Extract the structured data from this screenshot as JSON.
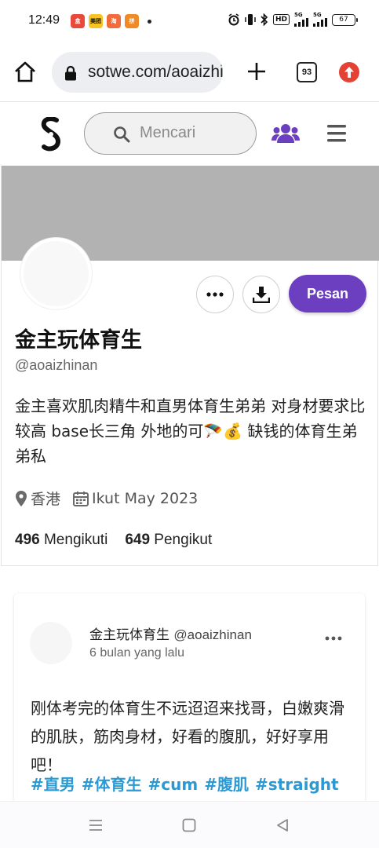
{
  "status_bar": {
    "time": "12:49",
    "battery": "67",
    "notifications": [
      {
        "name": "app-notification-1",
        "color": "#e8493b",
        "label": "盒"
      },
      {
        "name": "app-notification-meituan",
        "color": "#f7c423",
        "label": "美团"
      },
      {
        "name": "app-notification-3",
        "color": "#f26b3a",
        "label": "淘"
      },
      {
        "name": "app-notification-4",
        "color": "#f08a24",
        "label": "拼"
      }
    ],
    "network_1": "5G",
    "network_2": "5G",
    "hd": "HD"
  },
  "browser": {
    "url": "sotwe.com/aoaizhinan",
    "tab_count": "93"
  },
  "site_header": {
    "search_placeholder": "Mencari",
    "accent_color": "#6b3fbf"
  },
  "profile": {
    "message_button": "Pesan",
    "display_name": "金主玩体育生",
    "username": "@aoaizhinan",
    "bio": "金主喜欢肌肉精牛和直男体育生弟弟 对身材要求比较高 base长三角 外地的可🪂💰 缺钱的体育生弟弟私",
    "location": "香港",
    "joined": "Ikut May 2023",
    "following_count": "496",
    "following_label": "Mengikuti",
    "followers_count": "649",
    "followers_label": "Pengikut"
  },
  "post": {
    "author_name": "金主玩体育生",
    "author_handle": "@aoaizhinan",
    "time": "6 bulan yang lalu",
    "text": "刚体考完的体育生不远迢迢来找哥，白嫩爽滑的肌肤，筋肉身材，好看的腹肌，好好享用吧！",
    "tags": [
      "#直男",
      "#体育生",
      "#cum",
      "#腹肌",
      "#straight"
    ],
    "tag_color": "#2b9ad4"
  }
}
